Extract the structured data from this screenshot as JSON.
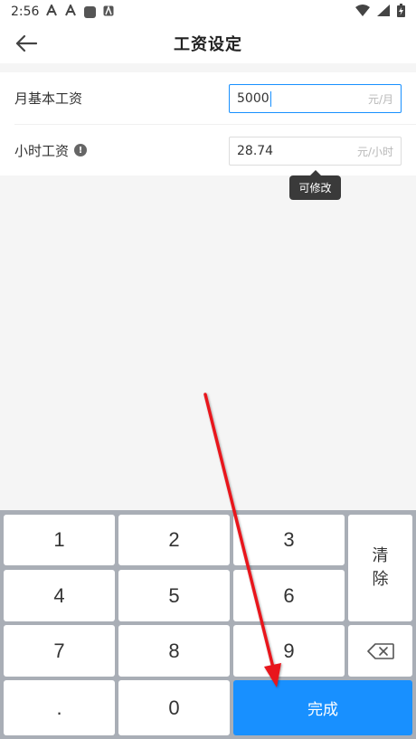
{
  "status_bar": {
    "time": "2:56",
    "icons": [
      "font-a-icon",
      "font-a-icon",
      "app-square-icon",
      "font-a-small-icon"
    ],
    "right_icons": [
      "wifi-icon",
      "signal-icon",
      "battery-charging-icon"
    ]
  },
  "app_bar": {
    "title": "工资设定",
    "back_icon": "arrow-left-icon"
  },
  "form": {
    "monthly": {
      "label": "月基本工资",
      "value": "5000",
      "unit": "元/月"
    },
    "hourly": {
      "label": "小时工资",
      "value": "28.74",
      "unit": "元/小时",
      "info_icon": "!"
    }
  },
  "tooltip": {
    "text": "可修改"
  },
  "keypad": {
    "k1": "1",
    "k2": "2",
    "k3": "3",
    "k4": "4",
    "k5": "5",
    "k6": "6",
    "k7": "7",
    "k8": "8",
    "k9": "9",
    "dot": ".",
    "k0": "0",
    "clear_top": "清",
    "clear_bottom": "除",
    "done": "完成",
    "backspace_icon": "backspace-icon"
  },
  "colors": {
    "accent": "#1890ff",
    "keypad_bg": "#a9aeb6",
    "arrow": "#e8141a",
    "tooltip_bg": "#3a3a3a"
  }
}
